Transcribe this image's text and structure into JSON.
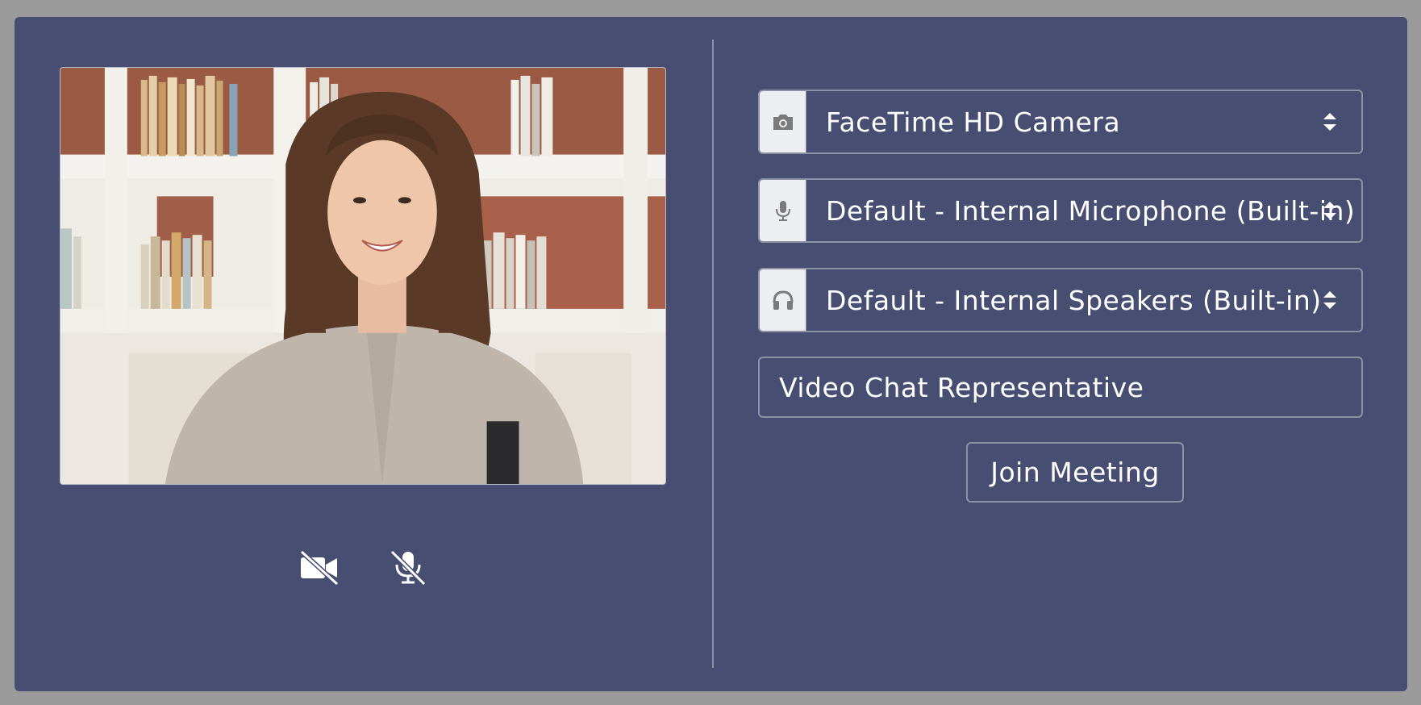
{
  "colors": {
    "page_background": "#9b9b9b",
    "panel_background": "#474e72",
    "border": "#8d91a4",
    "addon_background": "#eceef2",
    "icon_gray": "#7a7a7a",
    "text": "#ffffff"
  },
  "preview": {
    "image_description": "camera-preview-image"
  },
  "controls": {
    "video_icon": "video-off-icon",
    "mic_icon": "mic-off-icon"
  },
  "devices": {
    "camera": {
      "icon": "camera-icon",
      "selected": "FaceTime HD Camera"
    },
    "microphone": {
      "icon": "microphone-icon",
      "selected": "Default - Internal Microphone (Built-in)"
    },
    "speaker": {
      "icon": "headphones-icon",
      "selected": "Default - Internal Speakers (Built-in)"
    }
  },
  "name_field": {
    "value": "Video Chat Representative"
  },
  "join_button": {
    "label": "Join Meeting"
  }
}
